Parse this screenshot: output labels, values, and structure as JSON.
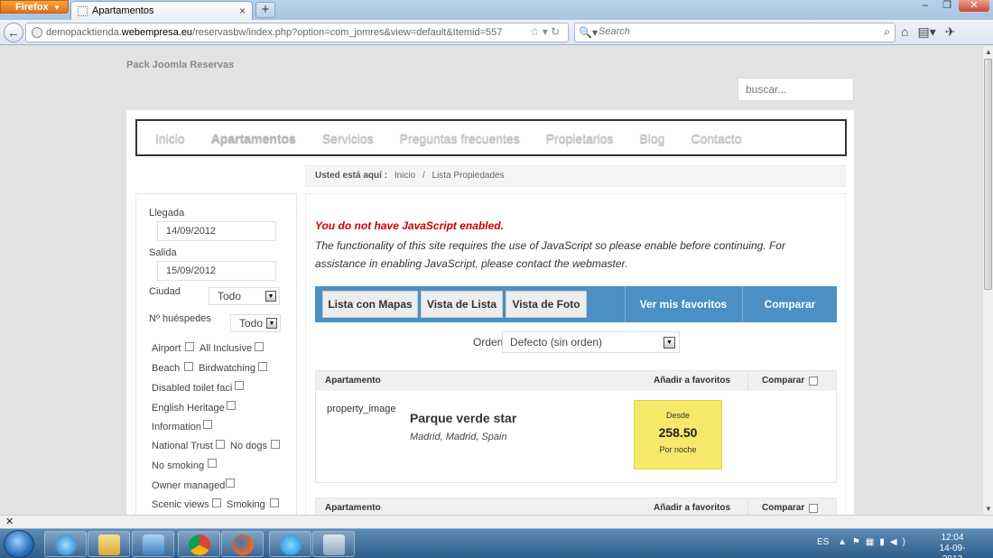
{
  "browser": {
    "app_button": "Firefox",
    "tab_title": "Apartamentos",
    "url_prefix": "demopacktienda.",
    "url_domain": "webempresa.eu",
    "url_path": "/reservasbw/index.php?option=com_jomres&view=default&Itemid=557",
    "search_placeholder": "Search"
  },
  "site": {
    "name": "Pack Joomla Reservas",
    "search_placeholder": "buscar..."
  },
  "menu": [
    "Inicio",
    "Apartamentos",
    "Servicios",
    "Preguntas frecuentes",
    "Propietarios",
    "Blog",
    "Contacto"
  ],
  "breadcrumb": {
    "label": "Usted está aquí :",
    "home": "Inicio",
    "sep": "/",
    "current": "Lista Propiedades"
  },
  "sidebar": {
    "arrival_label": "Llegada",
    "arrival_value": "14/09/2012",
    "departure_label": "Salida",
    "departure_value": "15/09/2012",
    "city_label": "Ciudad",
    "city_value": "Todo",
    "guests_label": "Nº huéspedes",
    "guests_value": "Todo",
    "features": [
      "Airport",
      "All Inclusive",
      "Beach",
      "Birdwatching",
      "Disabled toilet faci",
      "English Heritage",
      "Information",
      "National Trust",
      "No dogs",
      "No smoking",
      "Owner managed",
      "Scenic views",
      "Smoking"
    ]
  },
  "content": {
    "error_title": "You do not have JavaScript enabled.",
    "error_text": "The functionality of this site requires the use of JavaScript so please enable before continuing. For assistance in enabling JavaScript, please contact the webmaster.",
    "view_buttons": [
      "Lista con Mapas",
      "Vista de Lista",
      "Vista de Foto"
    ],
    "favorites_link": "Ver mis favoritos",
    "compare_link": "Comparar",
    "order_label": "Orden",
    "order_value": "Defecto (sin orden)",
    "columns": {
      "apartment": "Apartamento",
      "add_fav": "Añadir a favoritos",
      "compare": "Comparar"
    },
    "properties": [
      {
        "image_alt": "property_image",
        "name": "Parque verde star",
        "location": "Madrid, Madrid, Spain",
        "price_from": "Desde",
        "price": "258.50",
        "price_per": "Por noche"
      }
    ]
  },
  "taskbar": {
    "language": "ES",
    "time": "12:04",
    "date": "14-09-2012"
  },
  "colors": {
    "viewbar": "#4a90c4",
    "error": "#cc0000",
    "price_box": "#f6e868"
  }
}
